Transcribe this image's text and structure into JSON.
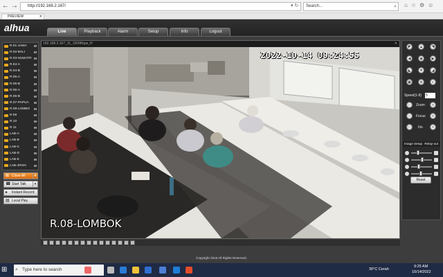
{
  "browser": {
    "address": "http://192.168.2.167/",
    "search_placeholder": "Search...",
    "tab_label": "PREVIEW"
  },
  "app": {
    "logo": "alhua",
    "nav": [
      "Live",
      "Playback",
      "Alarm",
      "Setup",
      "Info",
      "Logout"
    ],
    "active_nav": "Live"
  },
  "cameras": [
    {
      "label": "R.01-JAWA",
      "m": "M"
    },
    {
      "label": "R.02-BALI",
      "m": "M"
    },
    {
      "label": "R.03-SUMATR",
      "m": "M"
    },
    {
      "label": "R.04-A",
      "m": "M"
    },
    {
      "label": "R.04-B",
      "m": "M"
    },
    {
      "label": "R.05-A",
      "m": "M"
    },
    {
      "label": "R.05-B",
      "m": "M"
    },
    {
      "label": "R.06-A",
      "m": "M"
    },
    {
      "label": "R.06-B",
      "m": "M"
    },
    {
      "label": "R.07-PAPUA",
      "m": "M"
    },
    {
      "label": "R.08-LOMBO",
      "m": "M"
    },
    {
      "label": "R.09",
      "m": "M"
    },
    {
      "label": "R.10",
      "m": "M"
    },
    {
      "label": "R.11",
      "m": "M"
    },
    {
      "label": "LAB-A",
      "m": "M"
    },
    {
      "label": "LAB-B",
      "m": "M"
    },
    {
      "label": "LAB-C",
      "m": "M"
    },
    {
      "label": "LAB-D",
      "m": "M"
    },
    {
      "label": "LAB-E",
      "m": "M"
    },
    {
      "label": "LAB-JRGN",
      "m": "M"
    },
    {
      "label": "LAB-I",
      "m": "M"
    }
  ],
  "controls": {
    "close_all": "Close All",
    "start_talk": "Start Talk",
    "instant_record": "Instant Record",
    "local_play": "Local Play"
  },
  "video": {
    "title_text": "192.168.2.167_11_1009Kbps_H",
    "timestamp": "2022-10-14  09:24:55",
    "channel_name": "R.08-LOMBOK"
  },
  "ptz": {
    "speed_label": "Speed(1-8)",
    "speed_value": "5",
    "zoom": "Zoom",
    "focus": "Focus",
    "iris": "Iris"
  },
  "image_setup": {
    "header": "Image Setup",
    "relay_out": "Relay-out",
    "reset": "Reset",
    "sliders": [
      0.3,
      0.55,
      0.35,
      0.45
    ]
  },
  "copyright": "Copyright 2015 All Rights Reserved.",
  "taskbar": {
    "search": "Type here to search",
    "weather": "30°C  Cerah",
    "time": "9:25 AM",
    "date": "10/14/2022"
  }
}
